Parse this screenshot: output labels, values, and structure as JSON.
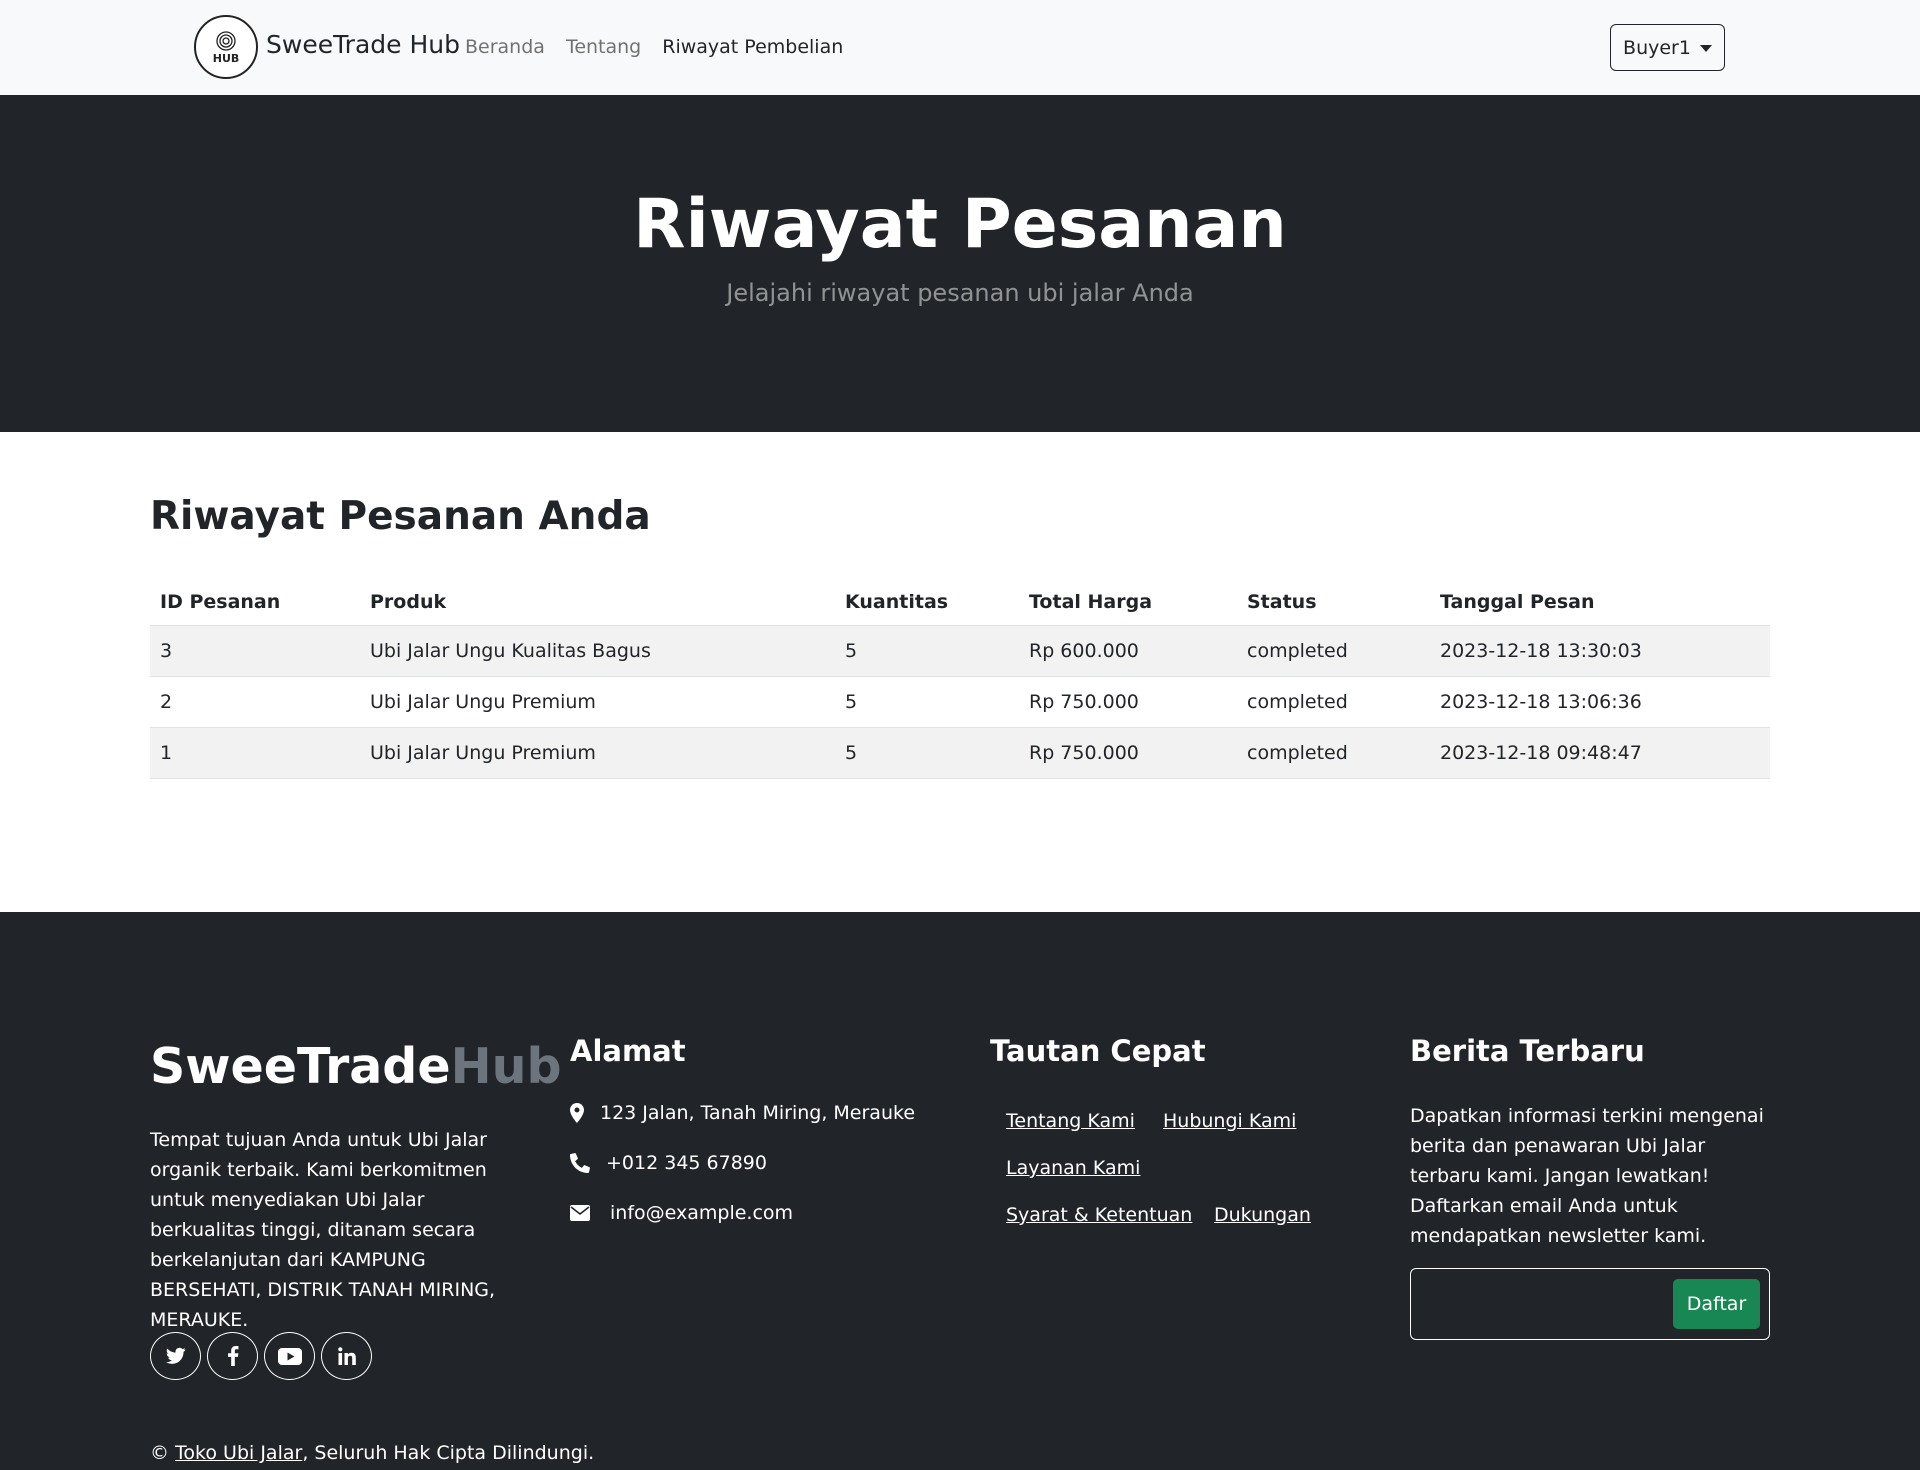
{
  "navbar": {
    "logo_text": "HUB",
    "brand": "SweeTrade Hub",
    "links": [
      {
        "label": "Beranda"
      },
      {
        "label": "Tentang"
      },
      {
        "label": "Riwayat Pembelian"
      }
    ],
    "user": "Buyer1"
  },
  "hero": {
    "title": "Riwayat Pesanan",
    "subtitle": "Jelajahi riwayat pesanan ubi jalar Anda"
  },
  "orders": {
    "heading": "Riwayat Pesanan Anda",
    "columns": [
      "ID Pesanan",
      "Produk",
      "Kuantitas",
      "Total Harga",
      "Status",
      "Tanggal Pesan"
    ],
    "rows": [
      [
        "3",
        "Ubi Jalar Ungu Kualitas Bagus",
        "5",
        "Rp 600.000",
        "completed",
        "2023-12-18 13:30:03"
      ],
      [
        "2",
        "Ubi Jalar Ungu Premium",
        "5",
        "Rp 750.000",
        "completed",
        "2023-12-18 13:06:36"
      ],
      [
        "1",
        "Ubi Jalar Ungu Premium",
        "5",
        "Rp 750.000",
        "completed",
        "2023-12-18 09:48:47"
      ]
    ]
  },
  "footer": {
    "brand_main": "SweeTrade",
    "brand_accent": "Hub",
    "description": "Tempat tujuan Anda untuk Ubi Jalar organik terbaik. Kami berkomitmen untuk menyediakan Ubi Jalar berkualitas tinggi, ditanam secara berkelanjutan dari KAMPUNG BERSEHATI, DISTRIK TANAH MIRING, MERAUKE.",
    "socials": [
      "twitter-icon",
      "facebook-icon",
      "youtube-icon",
      "linkedin-icon"
    ],
    "address": {
      "heading": "Alamat",
      "location": "123 Jalan, Tanah Miring, Merauke",
      "phone": "+012 345 67890",
      "email": "info@example.com"
    },
    "quick_links": {
      "heading": "Tautan Cepat",
      "links": [
        "Tentang Kami",
        "Hubungi Kami",
        "Layanan Kami",
        "Syarat & Ketentuan",
        "Dukungan"
      ]
    },
    "newsletter": {
      "heading": "Berita Terbaru",
      "text": "Dapatkan informasi terkini mengenai berita dan penawaran Ubi Jalar terbaru kami. Jangan lewatkan! Daftarkan email Anda untuk mendapatkan newsletter kami.",
      "input_value": "",
      "button": "Daftar"
    },
    "copyright": {
      "symbol": "©",
      "link": "Toko Ubi Jalar",
      "rest": ", Seluruh Hak Cipta Dilindungi."
    }
  }
}
